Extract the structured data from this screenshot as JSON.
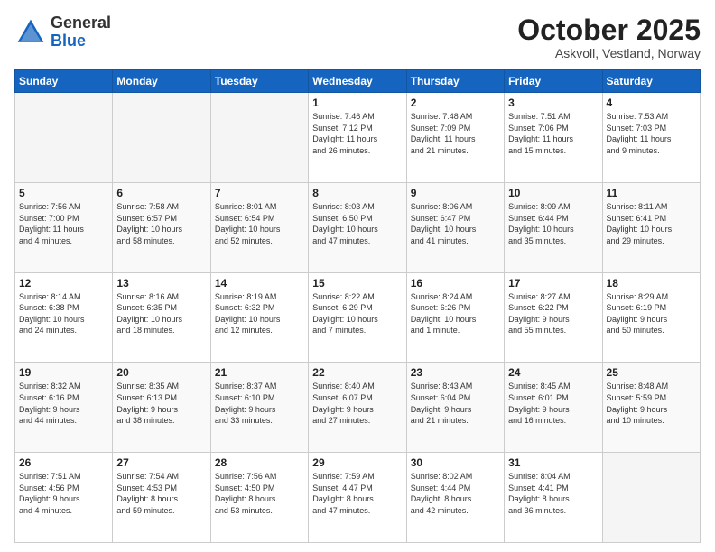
{
  "header": {
    "logo_general": "General",
    "logo_blue": "Blue",
    "month_title": "October 2025",
    "location": "Askvoll, Vestland, Norway"
  },
  "days_of_week": [
    "Sunday",
    "Monday",
    "Tuesday",
    "Wednesday",
    "Thursday",
    "Friday",
    "Saturday"
  ],
  "weeks": [
    [
      {
        "day": "",
        "info": ""
      },
      {
        "day": "",
        "info": ""
      },
      {
        "day": "",
        "info": ""
      },
      {
        "day": "1",
        "info": "Sunrise: 7:46 AM\nSunset: 7:12 PM\nDaylight: 11 hours\nand 26 minutes."
      },
      {
        "day": "2",
        "info": "Sunrise: 7:48 AM\nSunset: 7:09 PM\nDaylight: 11 hours\nand 21 minutes."
      },
      {
        "day": "3",
        "info": "Sunrise: 7:51 AM\nSunset: 7:06 PM\nDaylight: 11 hours\nand 15 minutes."
      },
      {
        "day": "4",
        "info": "Sunrise: 7:53 AM\nSunset: 7:03 PM\nDaylight: 11 hours\nand 9 minutes."
      }
    ],
    [
      {
        "day": "5",
        "info": "Sunrise: 7:56 AM\nSunset: 7:00 PM\nDaylight: 11 hours\nand 4 minutes."
      },
      {
        "day": "6",
        "info": "Sunrise: 7:58 AM\nSunset: 6:57 PM\nDaylight: 10 hours\nand 58 minutes."
      },
      {
        "day": "7",
        "info": "Sunrise: 8:01 AM\nSunset: 6:54 PM\nDaylight: 10 hours\nand 52 minutes."
      },
      {
        "day": "8",
        "info": "Sunrise: 8:03 AM\nSunset: 6:50 PM\nDaylight: 10 hours\nand 47 minutes."
      },
      {
        "day": "9",
        "info": "Sunrise: 8:06 AM\nSunset: 6:47 PM\nDaylight: 10 hours\nand 41 minutes."
      },
      {
        "day": "10",
        "info": "Sunrise: 8:09 AM\nSunset: 6:44 PM\nDaylight: 10 hours\nand 35 minutes."
      },
      {
        "day": "11",
        "info": "Sunrise: 8:11 AM\nSunset: 6:41 PM\nDaylight: 10 hours\nand 29 minutes."
      }
    ],
    [
      {
        "day": "12",
        "info": "Sunrise: 8:14 AM\nSunset: 6:38 PM\nDaylight: 10 hours\nand 24 minutes."
      },
      {
        "day": "13",
        "info": "Sunrise: 8:16 AM\nSunset: 6:35 PM\nDaylight: 10 hours\nand 18 minutes."
      },
      {
        "day": "14",
        "info": "Sunrise: 8:19 AM\nSunset: 6:32 PM\nDaylight: 10 hours\nand 12 minutes."
      },
      {
        "day": "15",
        "info": "Sunrise: 8:22 AM\nSunset: 6:29 PM\nDaylight: 10 hours\nand 7 minutes."
      },
      {
        "day": "16",
        "info": "Sunrise: 8:24 AM\nSunset: 6:26 PM\nDaylight: 10 hours\nand 1 minute."
      },
      {
        "day": "17",
        "info": "Sunrise: 8:27 AM\nSunset: 6:22 PM\nDaylight: 9 hours\nand 55 minutes."
      },
      {
        "day": "18",
        "info": "Sunrise: 8:29 AM\nSunset: 6:19 PM\nDaylight: 9 hours\nand 50 minutes."
      }
    ],
    [
      {
        "day": "19",
        "info": "Sunrise: 8:32 AM\nSunset: 6:16 PM\nDaylight: 9 hours\nand 44 minutes."
      },
      {
        "day": "20",
        "info": "Sunrise: 8:35 AM\nSunset: 6:13 PM\nDaylight: 9 hours\nand 38 minutes."
      },
      {
        "day": "21",
        "info": "Sunrise: 8:37 AM\nSunset: 6:10 PM\nDaylight: 9 hours\nand 33 minutes."
      },
      {
        "day": "22",
        "info": "Sunrise: 8:40 AM\nSunset: 6:07 PM\nDaylight: 9 hours\nand 27 minutes."
      },
      {
        "day": "23",
        "info": "Sunrise: 8:43 AM\nSunset: 6:04 PM\nDaylight: 9 hours\nand 21 minutes."
      },
      {
        "day": "24",
        "info": "Sunrise: 8:45 AM\nSunset: 6:01 PM\nDaylight: 9 hours\nand 16 minutes."
      },
      {
        "day": "25",
        "info": "Sunrise: 8:48 AM\nSunset: 5:59 PM\nDaylight: 9 hours\nand 10 minutes."
      }
    ],
    [
      {
        "day": "26",
        "info": "Sunrise: 7:51 AM\nSunset: 4:56 PM\nDaylight: 9 hours\nand 4 minutes."
      },
      {
        "day": "27",
        "info": "Sunrise: 7:54 AM\nSunset: 4:53 PM\nDaylight: 8 hours\nand 59 minutes."
      },
      {
        "day": "28",
        "info": "Sunrise: 7:56 AM\nSunset: 4:50 PM\nDaylight: 8 hours\nand 53 minutes."
      },
      {
        "day": "29",
        "info": "Sunrise: 7:59 AM\nSunset: 4:47 PM\nDaylight: 8 hours\nand 47 minutes."
      },
      {
        "day": "30",
        "info": "Sunrise: 8:02 AM\nSunset: 4:44 PM\nDaylight: 8 hours\nand 42 minutes."
      },
      {
        "day": "31",
        "info": "Sunrise: 8:04 AM\nSunset: 4:41 PM\nDaylight: 8 hours\nand 36 minutes."
      },
      {
        "day": "",
        "info": ""
      }
    ]
  ]
}
